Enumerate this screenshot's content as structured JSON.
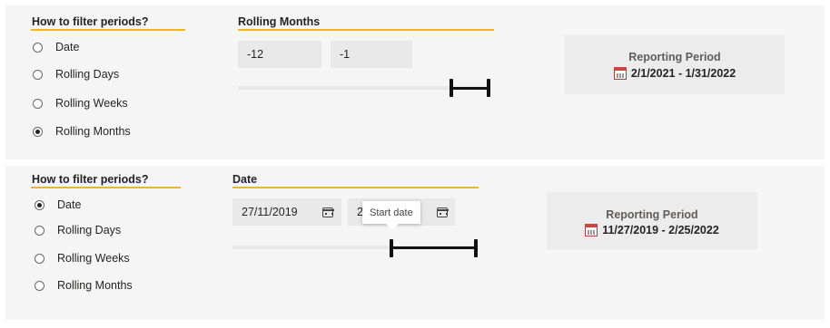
{
  "top": {
    "filter_title": "How to filter periods?",
    "options": [
      {
        "label": "Date",
        "checked": false
      },
      {
        "label": "Rolling Days",
        "checked": false
      },
      {
        "label": "Rolling Weeks",
        "checked": false
      },
      {
        "label": "Rolling Months",
        "checked": true
      }
    ],
    "slicer_title": "Rolling Months",
    "start_value": "-12",
    "end_value": "-1",
    "card_title": "Reporting Period",
    "card_value": "2/1/2021 - 1/31/2022"
  },
  "bottom": {
    "filter_title": "How to filter periods?",
    "options": [
      {
        "label": "Date",
        "checked": true
      },
      {
        "label": "Rolling Days",
        "checked": false
      },
      {
        "label": "Rolling Weeks",
        "checked": false
      },
      {
        "label": "Rolling Months",
        "checked": false
      }
    ],
    "slicer_title": "Date",
    "start_date": "27/11/2019",
    "end_date_partial": "2",
    "tooltip": "Start date",
    "card_title": "Reporting Period",
    "card_value": "11/27/2019 - 2/25/2022"
  },
  "colors": {
    "accent_underline": "#f0b429",
    "panel_bg": "#f5f5f5",
    "card_bg": "#ececec",
    "slider_range": "#111111"
  }
}
